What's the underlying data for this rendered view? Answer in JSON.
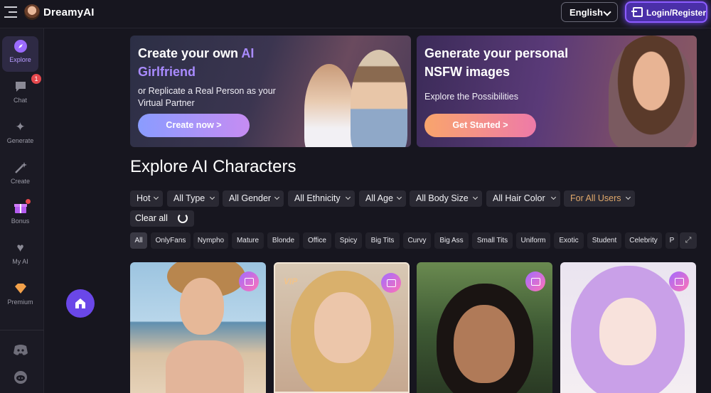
{
  "app": {
    "brand": "DreamyAI"
  },
  "header": {
    "language": "English",
    "login_label": "Login/Register"
  },
  "sidebar": {
    "items": [
      {
        "label": "Explore",
        "icon": "compass-icon"
      },
      {
        "label": "Chat",
        "icon": "chat-icon",
        "badge": "1"
      },
      {
        "label": "Generate",
        "icon": "sparkle-icon"
      },
      {
        "label": "Create",
        "icon": "magic-wand-icon"
      },
      {
        "label": "Bonus",
        "icon": "gift-icon"
      },
      {
        "label": "My AI",
        "icon": "heart-icon"
      },
      {
        "label": "Premium",
        "icon": "diamond-icon"
      }
    ],
    "bottom_icons": [
      "discord-icon",
      "reddit-icon"
    ]
  },
  "banners": [
    {
      "title_line1": "Create your own ",
      "title_accent1": "AI",
      "title_accent2": "Girlfriend",
      "subtitle_line1": "or Replicate a Real Person as your",
      "subtitle_line2": "Virtual Partner",
      "button": "Create now >"
    },
    {
      "title_line1": "Generate your personal",
      "title_line2": "NSFW images",
      "subtitle_line1": "Explore the Possibilities",
      "button": "Get Started >"
    }
  ],
  "section": {
    "title": "Explore AI Characters"
  },
  "filters": [
    "Hot",
    "All Type",
    "All Gender",
    "All Ethnicity",
    "All Age",
    "All Body Size",
    "All Hair Color",
    "For All Users"
  ],
  "clear_all": "Clear all",
  "tags": [
    "All",
    "OnlyFans",
    "Nympho",
    "Mature",
    "Blonde",
    "Office",
    "Spicy",
    "Big Tits",
    "Curvy",
    "Big Ass",
    "Small Tits",
    "Uniform",
    "Exotic",
    "Student",
    "Celebrity",
    "P"
  ],
  "cards": [
    {
      "vip": ""
    },
    {
      "vip": "VIP"
    },
    {
      "vip": ""
    },
    {
      "vip": ""
    }
  ],
  "colors": {
    "accent": "#8c5cff",
    "background": "#17161f",
    "filter_accent": "#e0a86a"
  }
}
